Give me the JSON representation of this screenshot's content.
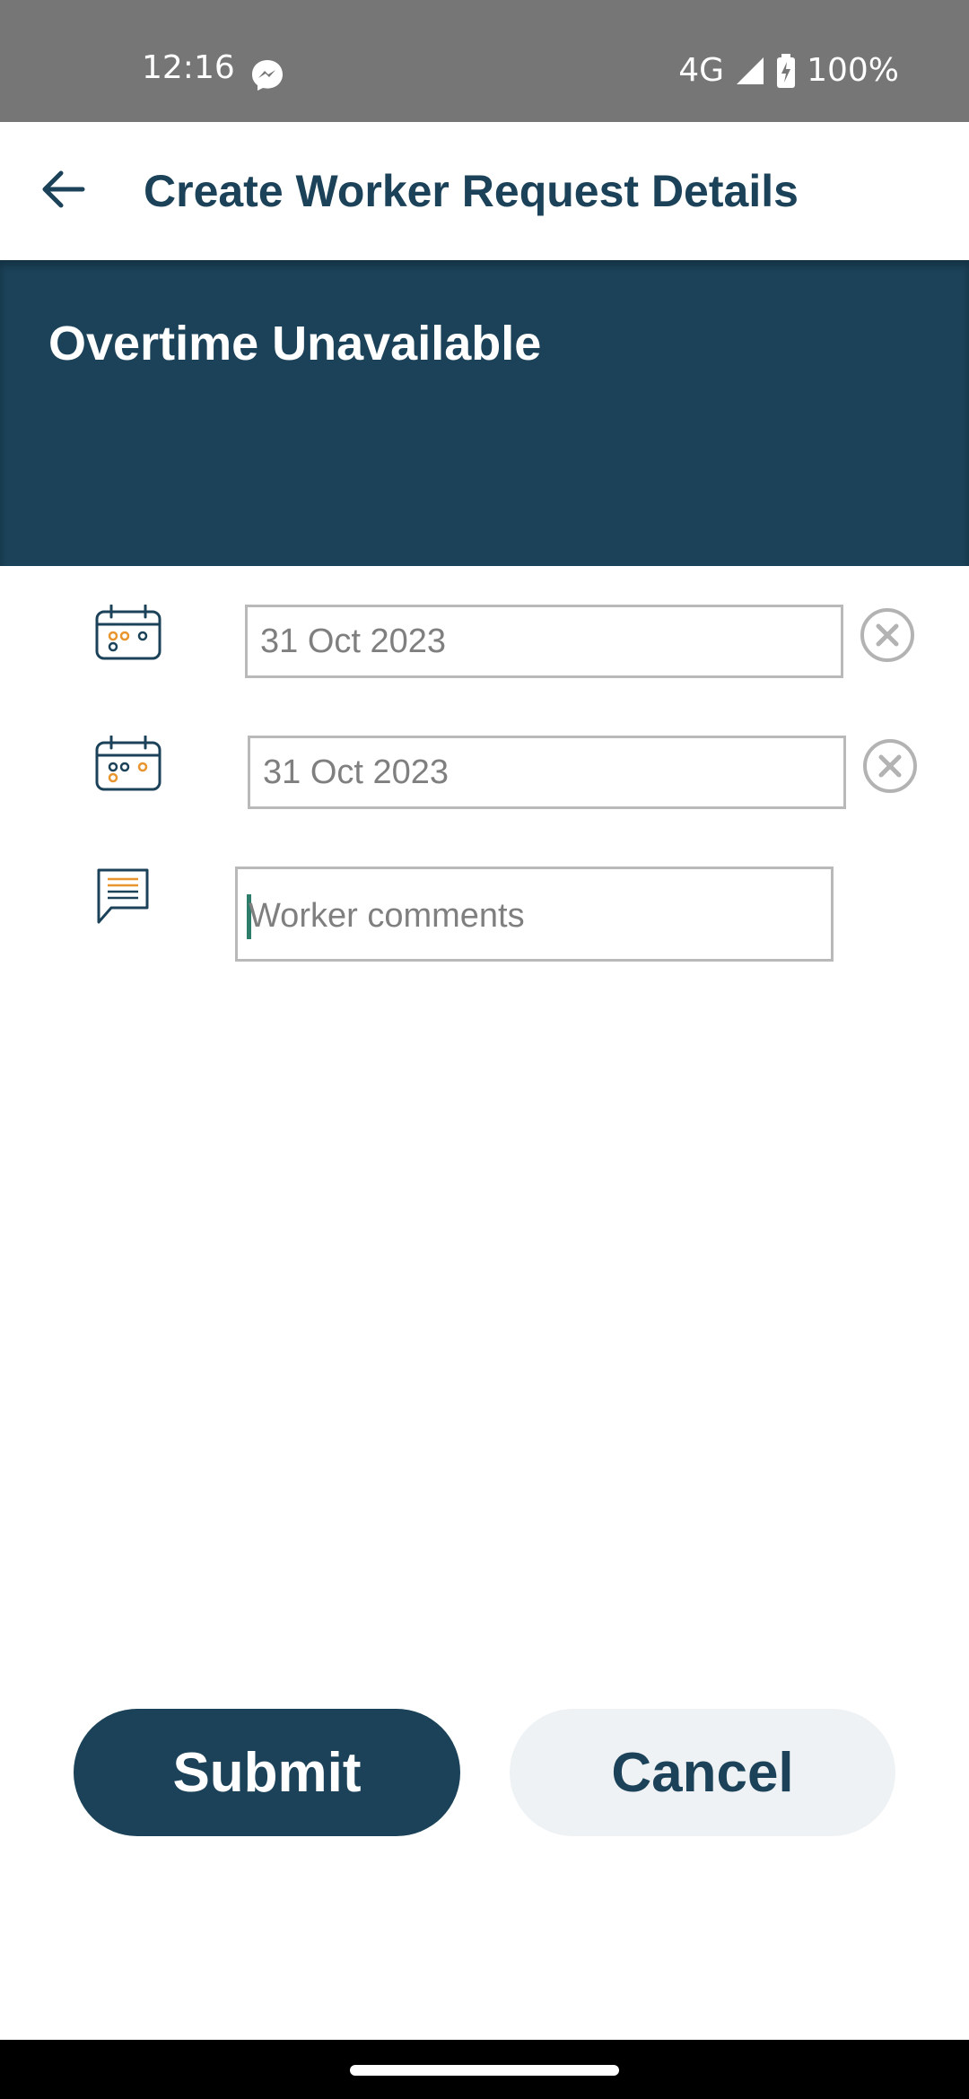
{
  "status_bar": {
    "time": "12:16",
    "network": "4G",
    "battery": "100%",
    "icons": [
      "messenger-icon",
      "signal-icon",
      "battery-charging-icon"
    ]
  },
  "app_bar": {
    "title": "Create Worker Request Details",
    "back_icon": "arrow-left-icon"
  },
  "banner": {
    "title": "Overtime Unavailable"
  },
  "form": {
    "start_date": {
      "value": "31 Oct 2023",
      "icon": "calendar-icon",
      "clear_icon": "clear-circle-icon"
    },
    "end_date": {
      "value": "31 Oct 2023",
      "icon": "calendar-icon",
      "clear_icon": "clear-circle-icon"
    },
    "comments": {
      "placeholder": "Worker comments",
      "value": "",
      "icon": "comment-icon"
    }
  },
  "actions": {
    "submit_label": "Submit",
    "cancel_label": "Cancel"
  },
  "colors": {
    "primary": "#1b4259",
    "status_bar": "#767676",
    "accent_orange": "#e8952f",
    "cancel_bg": "#eef2f4",
    "caret": "#2e7d6b"
  }
}
